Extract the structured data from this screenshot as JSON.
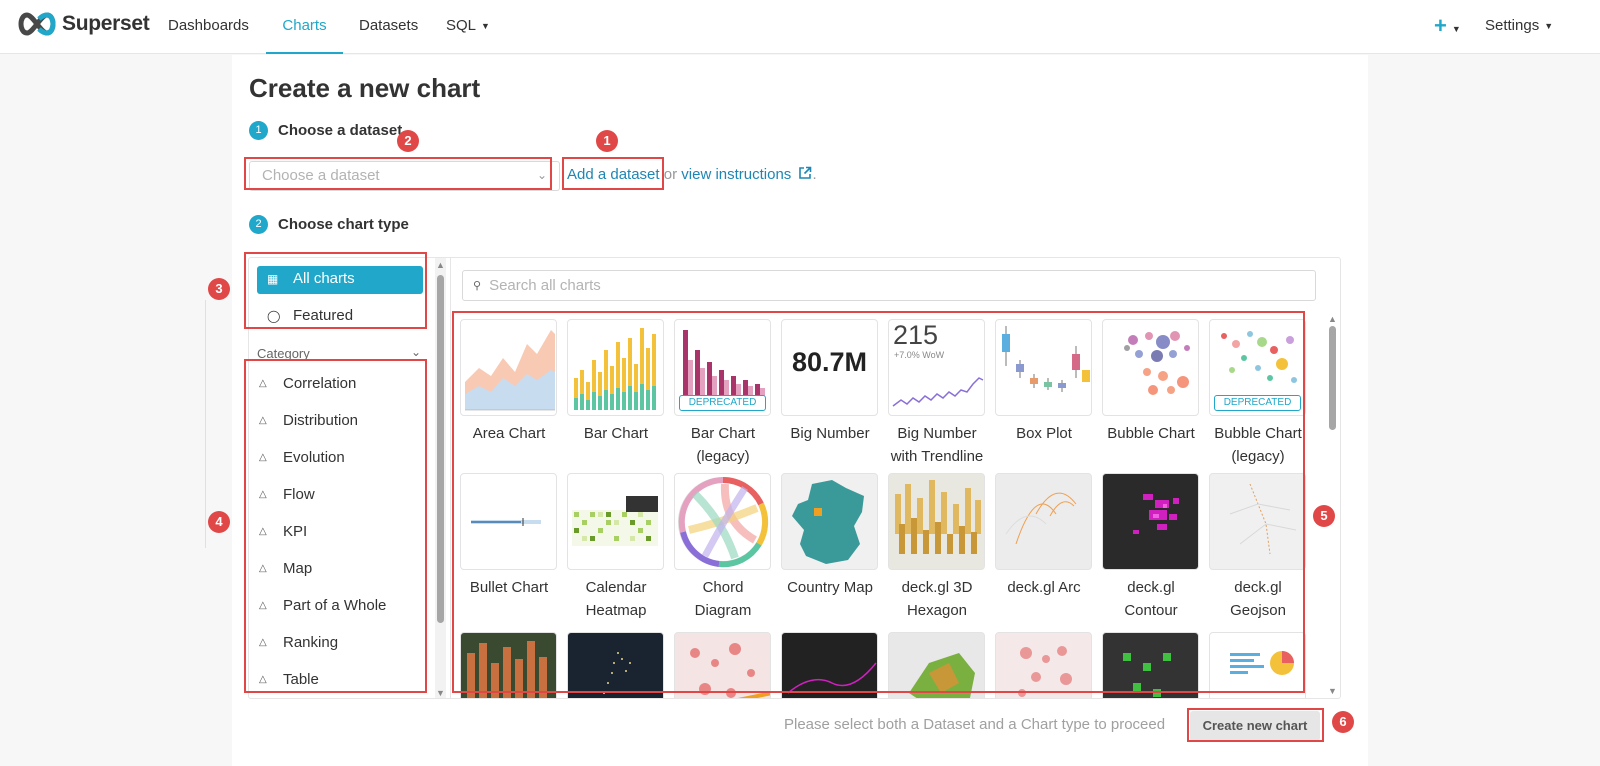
{
  "app": {
    "name": "Superset"
  },
  "nav": {
    "items": [
      {
        "label": "Dashboards",
        "active": false
      },
      {
        "label": "Charts",
        "active": true
      },
      {
        "label": "Datasets",
        "active": false
      },
      {
        "label": "SQL",
        "active": false,
        "has_caret": true
      }
    ],
    "plus_label": "+",
    "settings_label": "Settings"
  },
  "page": {
    "title": "Create a new chart"
  },
  "steps": {
    "dataset": {
      "num": "1",
      "title": "Choose a dataset"
    },
    "chart_type": {
      "num": "2",
      "title": "Choose chart type"
    }
  },
  "dataset_select": {
    "placeholder": "Choose a dataset"
  },
  "dataset_links": {
    "add": "Add a dataset",
    "or": " or ",
    "instructions": "view instructions",
    "period": "."
  },
  "sidebar": {
    "top_items": [
      {
        "label": "All charts",
        "icon": "table-icon",
        "selected": true
      },
      {
        "label": "Featured",
        "icon": "fire-icon",
        "selected": false
      }
    ],
    "category_header": "Category",
    "categories": [
      "Correlation",
      "Distribution",
      "Evolution",
      "Flow",
      "KPI",
      "Map",
      "Part of a Whole",
      "Ranking",
      "Table"
    ]
  },
  "search": {
    "placeholder": "Search all charts"
  },
  "charts": [
    {
      "label": "Area Chart",
      "label2": "",
      "deprecated": false
    },
    {
      "label": "Bar Chart",
      "label2": "",
      "deprecated": false
    },
    {
      "label": "Bar Chart",
      "label2": "(legacy)",
      "deprecated": true
    },
    {
      "label": "Big Number",
      "label2": "",
      "deprecated": false,
      "thumb_text": "80.7M"
    },
    {
      "label": "Big Number",
      "label2": "with Trendline",
      "deprecated": false,
      "thumb_text": "215",
      "thumb_sub": "+7.0% WoW"
    },
    {
      "label": "Box Plot",
      "label2": "",
      "deprecated": false
    },
    {
      "label": "Bubble Chart",
      "label2": "",
      "deprecated": false
    },
    {
      "label": "Bubble Chart",
      "label2": "(legacy)",
      "deprecated": true
    },
    {
      "label": "Bullet Chart",
      "label2": "",
      "deprecated": false
    },
    {
      "label": "Calendar",
      "label2": "Heatmap",
      "deprecated": false
    },
    {
      "label": "Chord",
      "label2": "Diagram",
      "deprecated": false
    },
    {
      "label": "Country Map",
      "label2": "",
      "deprecated": false
    },
    {
      "label": "deck.gl 3D",
      "label2": "Hexagon",
      "deprecated": false
    },
    {
      "label": "deck.gl Arc",
      "label2": "",
      "deprecated": false
    },
    {
      "label": "deck.gl",
      "label2": "Contour",
      "deprecated": false
    },
    {
      "label": "deck.gl",
      "label2": "Geojson",
      "deprecated": false
    }
  ],
  "deprecated_badge": "DEPRECATED",
  "footer": {
    "message": "Please select both a Dataset and a Chart type to proceed",
    "create_button": "Create new chart"
  },
  "annotations": [
    "1",
    "2",
    "3",
    "4",
    "5",
    "6"
  ],
  "colors": {
    "accent": "#20a7c9",
    "annotation": "#e04848",
    "link": "#1f86b3"
  }
}
